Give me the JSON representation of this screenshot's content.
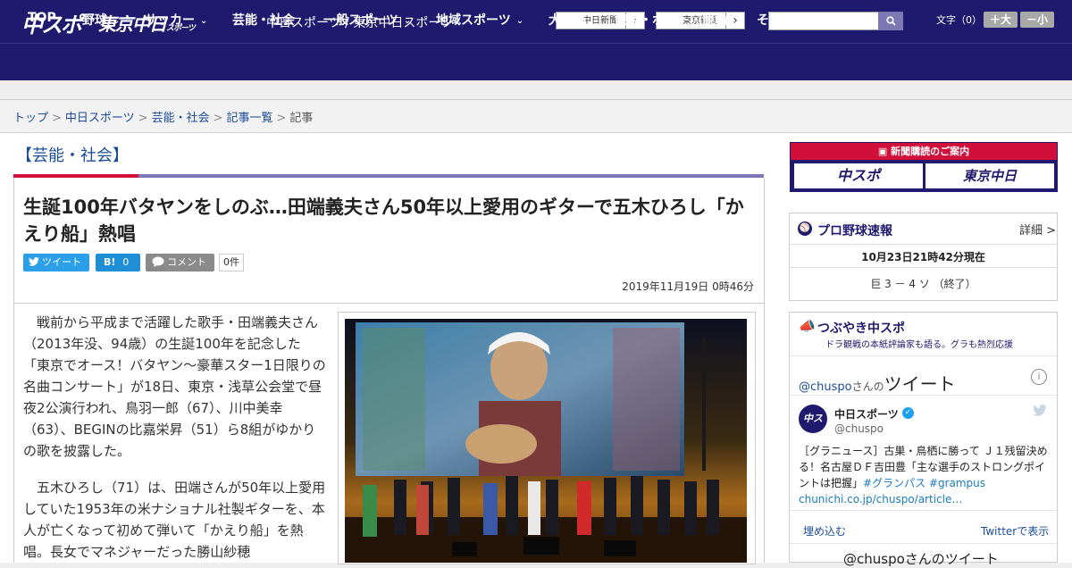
{
  "header": {
    "logo_chuspo": "中スポ",
    "logo_tokyo": "東京中日",
    "logo_tokyo_small": "スポーツ",
    "site_title": "中日スポーツ / 東京中日スポーツ",
    "paper_links": [
      "中日新聞",
      "東京新聞"
    ],
    "fontsize_label": "文字（0）",
    "font_bigger": "＋大",
    "font_smaller": "－小"
  },
  "nav": [
    {
      "label": "TOP",
      "has_menu": false
    },
    {
      "label": "野球",
      "has_menu": true
    },
    {
      "label": "サッカー",
      "has_menu": true
    },
    {
      "label": "芸能・社会",
      "has_menu": false
    },
    {
      "label": "一般スポーツ",
      "has_menu": true
    },
    {
      "label": "地域スポーツ",
      "has_menu": true
    },
    {
      "label": "大相撲",
      "has_menu": false
    },
    {
      "label": "競馬・ボート・競輪",
      "has_menu": false
    },
    {
      "label": "その他",
      "has_menu": true
    }
  ],
  "breadcrumb": [
    "トップ",
    "中日スポーツ",
    "芸能・社会",
    "記事一覧",
    "記事"
  ],
  "article": {
    "section": "【芸能・社会】",
    "headline": "生誕100年バタヤンをしのぶ…田端義夫さん50年以上愛用のギターで五木ひろし「かえり船」熱唱",
    "share_tweet": "ツイート",
    "share_hatena_icon": "B!",
    "share_hatena_count": "0",
    "share_comment": "コメント",
    "comment_count": "0件",
    "date": "2019年11月19日 0時46分",
    "paragraphs": [
      "戦前から平成まで活躍した歌手・田端義夫さん（2013年没、94歳）の生誕100年を記念した「東京でオース！バタヤン～豪華スター1日限りの名曲コンサート」が18日、東京・浅草公会堂で昼夜2公演行われ、鳥羽一郎（67）、川中美幸（63）、BEGINの比嘉栄昇（51）ら8組がゆかりの歌を披露した。",
      "五木ひろし（71）は、田端さんが50年以上愛用していた1953年の米ナショナル社製ギターを、本人が亡くなって初めて弾いて「かえり船」を熱唱。長女でマネジャーだった勝山紗穂"
    ]
  },
  "sidebar": {
    "subscribe_title": "新聞購読のご案内",
    "subscribe_logo1": "中スポ",
    "subscribe_logo2": "東京中日",
    "score_title": "プロ野球速報",
    "score_detail": "詳細 >",
    "score_time": "10月23日21時42分現在",
    "score_result": "巨 3 － 4 ソ （終了）",
    "tweets_title": "つぶやき中スポ",
    "tweets_sub": "ドラ観戦の本紙評論家も語る。グラも熱烈応援",
    "tweets_handle": "@chuspo",
    "tweets_handle_suffix": "さんの",
    "tweets_handle_big": "ツイート",
    "tweet_name": "中日スポーツ",
    "tweet_user": "@chuspo",
    "tweet_avatar": "中スポ",
    "tweet_text": "［グラニュース］古巣・鳥栖に勝って Ｊ１残留決める！名古屋ＤＦ吉田豊「主な選手のストロングポイントは把握」",
    "tweet_tags": "#グランパス #grampus",
    "tweet_link": "chunichi.co.jp/chuspo/article…",
    "embed": "埋め込む",
    "view_on_twitter": "Twitterで表示",
    "footer": "@chuspoさんのツイート"
  },
  "colors": {
    "brand_navy": "#1f1a6e",
    "accent_red": "#d0103a",
    "accent_purple": "#7d77b5"
  }
}
